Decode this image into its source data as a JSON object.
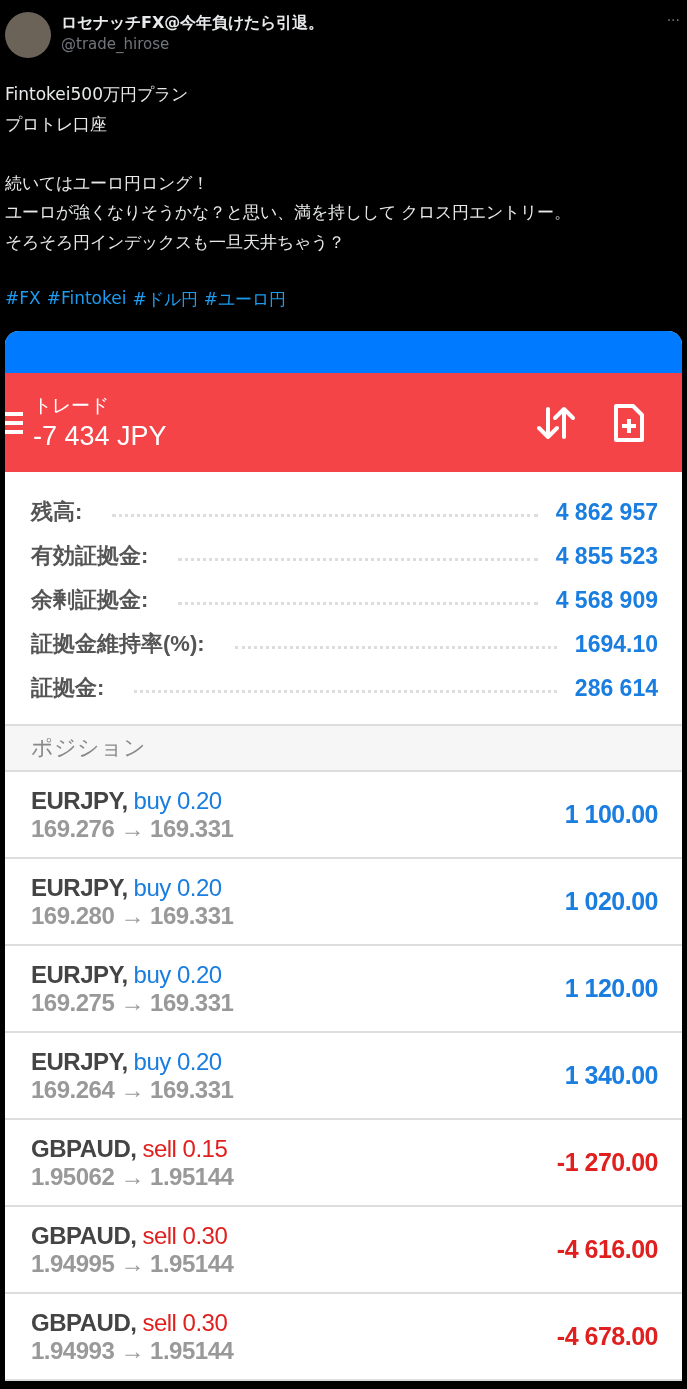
{
  "tweet": {
    "display_name": "ロセナッチFX@今年負けたら引退。",
    "handle": "@trade_hirose",
    "more": "···",
    "paragraphs": [
      [
        "Fintokei500万円プラン",
        "プロトレ口座"
      ],
      [
        "続いてはユーロ円ロング！",
        "ユーロが強くなりそうかな？と思い、満を持しして クロス円エントリー。",
        "そろそろ円インデックスも一旦天井ちゃう？"
      ]
    ],
    "hashtags": [
      "#FX",
      "#Fintokei",
      "#ドル円",
      "#ユーロ円"
    ]
  },
  "app": {
    "title": "トレード",
    "profit": "-7 434 JPY",
    "summary": [
      {
        "label": "残高:",
        "value": "4 862 957"
      },
      {
        "label": "有効証拠金:",
        "value": "4 855 523"
      },
      {
        "label": "余剰証拠金:",
        "value": "4 568 909"
      },
      {
        "label": "証拠金維持率(%):",
        "value": "1694.10"
      },
      {
        "label": "証拠金:",
        "value": "286 614"
      }
    ],
    "section": "ポジション",
    "positions": [
      {
        "symbol": "EURJPY,",
        "kind": "buy",
        "side": "buy 0.20",
        "prices": "169.276 → 169.331",
        "profit": "1 100.00"
      },
      {
        "symbol": "EURJPY,",
        "kind": "buy",
        "side": "buy 0.20",
        "prices": "169.280 → 169.331",
        "profit": "1 020.00"
      },
      {
        "symbol": "EURJPY,",
        "kind": "buy",
        "side": "buy 0.20",
        "prices": "169.275 → 169.331",
        "profit": "1 120.00"
      },
      {
        "symbol": "EURJPY,",
        "kind": "buy",
        "side": "buy 0.20",
        "prices": "169.264 → 169.331",
        "profit": "1 340.00"
      },
      {
        "symbol": "GBPAUD,",
        "kind": "sell",
        "side": "sell 0.15",
        "prices": "1.95062 → 1.95144",
        "profit": "-1 270.00"
      },
      {
        "symbol": "GBPAUD,",
        "kind": "sell",
        "side": "sell 0.30",
        "prices": "1.94995 → 1.95144",
        "profit": "-4 616.00"
      },
      {
        "symbol": "GBPAUD,",
        "kind": "sell",
        "side": "sell 0.30",
        "prices": "1.94993 → 1.95144",
        "profit": "-4 678.00"
      }
    ]
  }
}
